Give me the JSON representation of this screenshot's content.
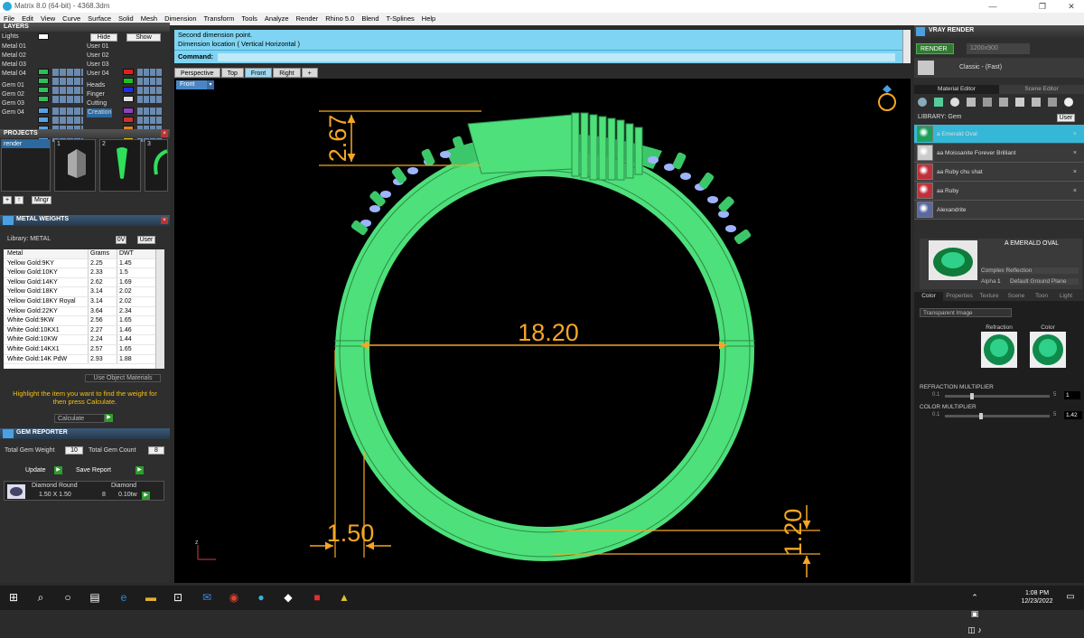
{
  "window": {
    "title": "Matrix 8.0 (64-bit) - 4368.3dm",
    "controls": [
      "—",
      "❐",
      "✕"
    ]
  },
  "menu": [
    "File",
    "Edit",
    "View",
    "Curve",
    "Surface",
    "Solid",
    "Mesh",
    "Dimension",
    "Transform",
    "Tools",
    "Analyze",
    "Render",
    "Rhino 5.0",
    "Blend",
    "T-Splines",
    "Help"
  ],
  "layers": {
    "title": "LAYERS",
    "lights_label": "Lights",
    "hide_label": "Hide",
    "show_label": "Show",
    "left": [
      {
        "name": "Metal 01",
        "color": "#2fbf5a"
      },
      {
        "name": "Metal 02",
        "color": "#2fbf5a"
      },
      {
        "name": "Metal 03",
        "color": "#2fbf5a"
      },
      {
        "name": "Metal 04",
        "color": "#2fbf5a"
      },
      {
        "name": "Gem 01",
        "color": "#5aa0e0"
      },
      {
        "name": "Gem 02",
        "color": "#5aa0e0"
      },
      {
        "name": "Gem 03",
        "color": "#5aa0e0"
      },
      {
        "name": "Gem 04",
        "color": "#5aa0e0"
      }
    ],
    "right": [
      {
        "name": "User 01",
        "color": "#e02020"
      },
      {
        "name": "User 02",
        "color": "#20c020"
      },
      {
        "name": "User 03",
        "color": "#2030e0"
      },
      {
        "name": "User 04",
        "color": "#e0e0e0"
      },
      {
        "name": "Heads",
        "color": "#9040c0"
      },
      {
        "name": "Finger",
        "color": "#d03030"
      },
      {
        "name": "Cutting",
        "color": "#e08020"
      },
      {
        "name": "Creation",
        "color": "#e0c020"
      }
    ]
  },
  "projects": {
    "title": "PROJECTS",
    "item": "render",
    "thumbs": [
      "1",
      "2",
      "3"
    ],
    "mngr": "Mngr"
  },
  "metal_weights": {
    "title": "METAL WEIGHTS",
    "library": "Library: METAL",
    "user": "User",
    "headers": [
      "Metal",
      "Grams",
      "DWT"
    ],
    "rows": [
      [
        "Yellow Gold:9KY",
        "2.25",
        "1.45"
      ],
      [
        "Yellow Gold:10KY",
        "2.33",
        "1.5"
      ],
      [
        "Yellow Gold:14KY",
        "2.62",
        "1.69"
      ],
      [
        "Yellow Gold:18KY",
        "3.14",
        "2.02"
      ],
      [
        "Yellow Gold:18KY Royal",
        "3.14",
        "2.02"
      ],
      [
        "Yellow Gold:22KY",
        "3.64",
        "2.34"
      ],
      [
        "White Gold:9KW",
        "2.56",
        "1.65"
      ],
      [
        "White Gold:10KX1",
        "2.27",
        "1.46"
      ],
      [
        "White Gold:10KW",
        "2.24",
        "1.44"
      ],
      [
        "White Gold:14KX1",
        "2.57",
        "1.65"
      ],
      [
        "White Gold:14K PdW",
        "2.93",
        "1.88"
      ]
    ],
    "use_object_materials": "Use Object Materials",
    "hint": "Highlight the item you want to find the weight for then press Calculate.",
    "calculate": "Calculate"
  },
  "gem_reporter": {
    "title": "GEM REPORTER",
    "total_weight_label": "Total Gem Weight",
    "total_weight": "10",
    "total_count_label": "Total Gem Count",
    "total_count": "8",
    "update": "Update",
    "save_report": "Save Report",
    "gem": {
      "shape": "Diamond Round",
      "size": "1.50 X 1.50",
      "material": "Diamond",
      "count": "8",
      "weight": "0.10tw"
    }
  },
  "command": {
    "line1": "Second dimension point.",
    "line2": "Dimension location ( Vertical  Horizontal )",
    "label": "Command:"
  },
  "viewport_tabs": [
    "Perspective",
    "Top",
    "Front",
    "Right",
    "+"
  ],
  "viewport": {
    "name": "Front",
    "dims": {
      "top_height": "2.67",
      "diameter": "18.20",
      "band_width": "1.50",
      "band_thickness": "1.20"
    },
    "axis_z": "z",
    "accent": "#f5a623",
    "ring_color": "#4ee07a"
  },
  "vray": {
    "title": "VRAY RENDER",
    "render": "RENDER",
    "resolution": "1200x900",
    "preset": "Classic - (Fast)",
    "tabs": [
      "Material Editor",
      "Scene Editor"
    ],
    "library": "LIBRARY: Gem",
    "user": "User",
    "items": [
      {
        "name": "a Emerald Oval",
        "color": "#1aa05a"
      },
      {
        "name": "aa Moissanite Forever Brilliant",
        "color": "#cccccc"
      },
      {
        "name": "aa Ruby chu shat",
        "color": "#c0303a"
      },
      {
        "name": "aa Ruby",
        "color": "#c0303a"
      },
      {
        "name": "Alexandrite",
        "color": "#5a6aa0"
      }
    ],
    "selected_name": "A EMERALD OVAL",
    "complex": "Complex Reflection",
    "alpha": "Alpha",
    "alpha_val": "1",
    "ground": "Default Ground Plane",
    "subtabs": [
      "Color",
      "Properties",
      "Texture",
      "Scene",
      "Toon",
      "Light"
    ],
    "transparent": "Transparent Image",
    "refraction": "Refraction",
    "color": "Color",
    "refraction_mult": "REFRACTION MULTIPLIER",
    "refraction_min": "0.1",
    "refraction_max": "5",
    "refraction_val": "1",
    "color_mult": "COLOR MULTIPLIER",
    "color_min": "0.1",
    "color_max": "5",
    "color_val": "1.42"
  },
  "taskbar": {
    "time": "1:08 PM",
    "date": "12/23/2022"
  }
}
